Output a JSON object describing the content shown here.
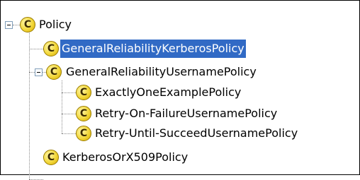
{
  "tree": {
    "root": {
      "label": "Policy",
      "expanded": true,
      "icon": "class-icon"
    },
    "children": [
      {
        "label": "GeneralReliabilityKerberosPolicy",
        "selected": true,
        "icon": "class-icon"
      },
      {
        "label": "GeneralReliabilityUsernamePolicy",
        "expanded": true,
        "icon": "class-icon",
        "children": [
          {
            "label": "ExactlyOneExamplePolicy",
            "icon": "class-icon"
          },
          {
            "label": "Retry-On-FailureUsernamePolicy",
            "icon": "class-icon"
          },
          {
            "label": "Retry-Until-SucceedUsernamePolicy",
            "icon": "class-icon"
          }
        ]
      },
      {
        "label": "KerberosOrX509Policy",
        "icon": "class-icon"
      }
    ],
    "icon_letter": "C",
    "colors": {
      "selection": "#316ac5",
      "icon_fill": "#f2d73a",
      "border": "#000000"
    }
  }
}
